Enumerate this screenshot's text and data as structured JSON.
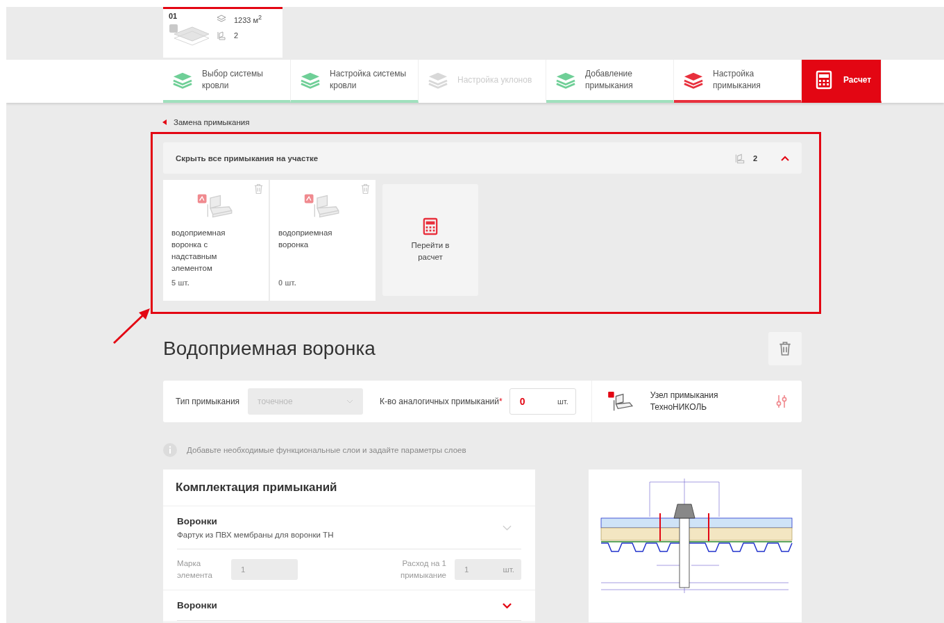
{
  "project_tab": {
    "number": "01",
    "area": "1233 м$^{2}$",
    "adjacency_count": "2"
  },
  "steps": [
    {
      "label": "Выбор системы кровли",
      "kind": "done"
    },
    {
      "label": "Настройка системы кровли",
      "kind": "done"
    },
    {
      "label": "Настройка уклонов",
      "kind": "disabled"
    },
    {
      "label": "Добавление примыкания",
      "kind": "done"
    },
    {
      "label": "Настройка примыкания",
      "kind": "current"
    },
    {
      "label": "Расчет",
      "kind": "action"
    }
  ],
  "breadcrumb": "Замена примыкания",
  "group": {
    "title": "Скрыть все примыкания на участке",
    "count": "2",
    "expanded": true,
    "cards": [
      {
        "name": "водоприемная воронка с надставным элементом",
        "quantity": "5 шт."
      },
      {
        "name": "водоприемная воронка",
        "quantity": "0 шт."
      }
    ],
    "calc_link": "Перейти в расчет"
  },
  "title": "Водоприемная воронка",
  "settings": {
    "type_label": "Тип примыкания",
    "type_value": "точечное",
    "count_label": "К-во аналогичных примыканий",
    "required_mark": "*",
    "count_value": "0",
    "count_unit": "шт.",
    "node_label": "Узел примыкания ТехноНИКОЛЬ"
  },
  "hint": "Добавьте необходимые функциональные слои и задайте параметры слоев",
  "kit": {
    "title": "Комплектация примыканий",
    "items": [
      {
        "title": "Воронки",
        "subtitle": "Фартук из ПВХ мембраны для воронки ТН",
        "expanded": true,
        "mark_label": "Марка элемента",
        "mark_value": "1",
        "usage_label": "Расход на 1 примыкание",
        "usage_value": "1",
        "usage_unit": "шт."
      },
      {
        "title": "Воронки",
        "expanded": false
      }
    ]
  }
}
